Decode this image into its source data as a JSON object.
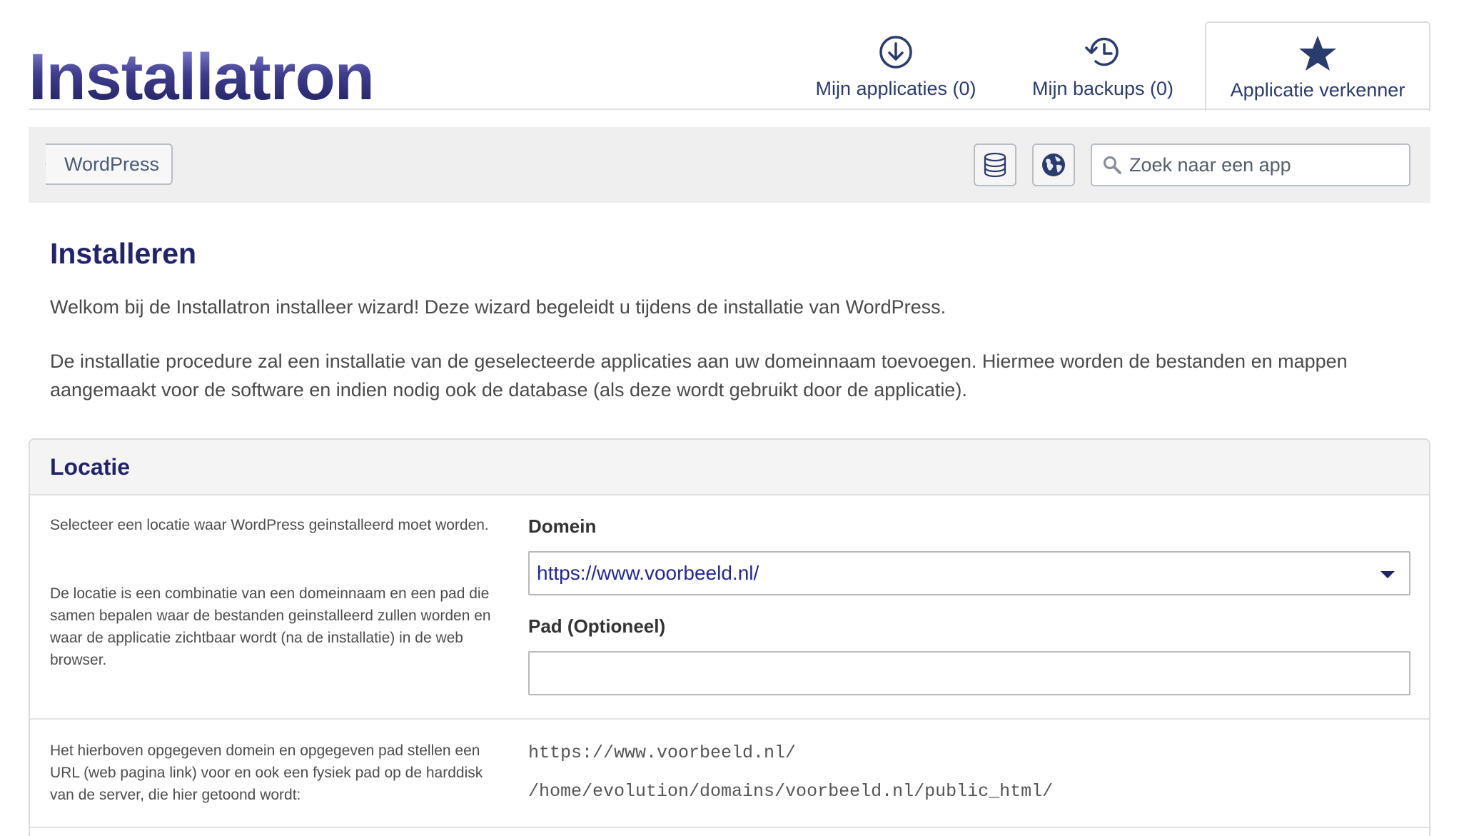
{
  "app": {
    "logo_text": "Installatron"
  },
  "nav": {
    "tabs": [
      {
        "label": "Mijn applicaties (0)",
        "icon": "download-circle-icon"
      },
      {
        "label": "Mijn backups (0)",
        "icon": "history-icon"
      },
      {
        "label": "Applicatie verkenner",
        "icon": "star-icon",
        "active": true
      }
    ]
  },
  "toolbar": {
    "breadcrumb": "WordPress",
    "database_icon": "database-icon",
    "globe_icon": "globe-icon",
    "search_placeholder": "Zoek naar een app"
  },
  "main": {
    "title": "Installeren",
    "intro_1": "Welkom bij de Installatron installeer wizard! Deze wizard begeleidt u tijdens de installatie van WordPress.",
    "intro_2": "De installatie procedure zal een installatie van de geselecteerde applicaties aan uw domeinnaam toevoegen. Hiermee worden de bestanden en mappen aangemaakt voor de software en indien nodig ook de database (als deze wordt gebruikt door de applicatie)."
  },
  "location": {
    "title": "Locatie",
    "help_1": "Selecteer een locatie waar WordPress geinstalleerd moet worden.",
    "help_2": "De locatie is een combinatie van een domeinnaam en een pad die samen bepalen waar de bestanden geinstalleerd zullen worden en waar de applicatie zichtbaar wordt (na de installatie) in de web browser.",
    "domain_label": "Domein",
    "domain_value": "https://www.voorbeeld.nl/",
    "path_label": "Pad (Optioneel)",
    "path_value": "",
    "help_3": "Het hierboven opgegeven domein en opgegeven pad stellen een URL (web pagina link) voor en ook een fysiek pad op de harddisk van de server, die hier getoond wordt:",
    "result_url": "https://www.voorbeeld.nl/",
    "result_path": "/home/evolution/domains/voorbeeld.nl/public_html/"
  },
  "colors": {
    "accent": "#22246a",
    "link": "#23259a",
    "toolbar_bg": "#efefef"
  }
}
